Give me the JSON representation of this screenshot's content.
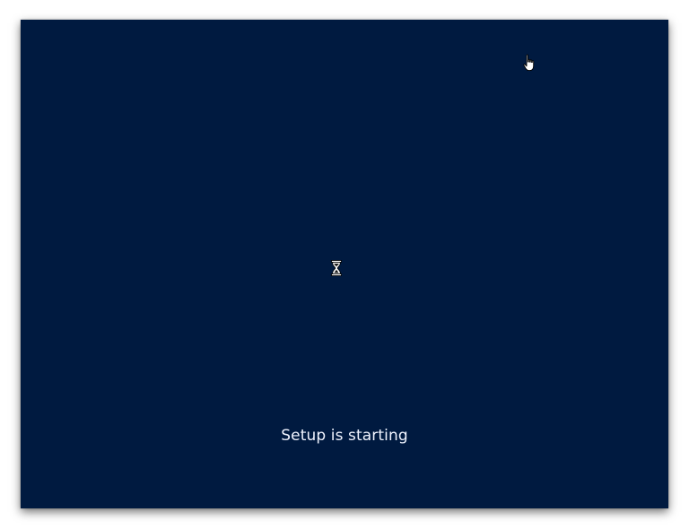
{
  "screen": {
    "background_color": "#001a40",
    "status_text": "Setup is starting",
    "busy_indicator_icon": "hourglass-icon",
    "mouse_pointer_icon": "hand-pointer-icon"
  }
}
